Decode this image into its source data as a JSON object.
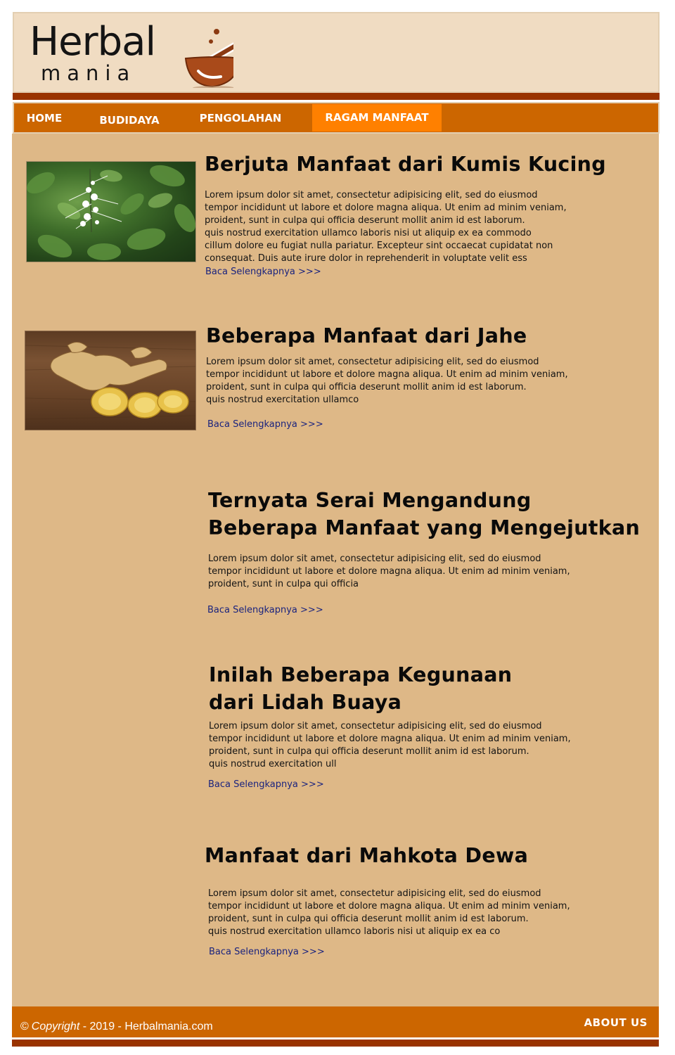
{
  "brand": {
    "logo_top": "Herbal",
    "logo_bottom": "mania"
  },
  "nav": [
    {
      "label": "HOME"
    },
    {
      "label": "BUDIDAYA"
    },
    {
      "label": "PENGOLAHAN"
    },
    {
      "label": "RAGAM MANFAAT",
      "active": true
    }
  ],
  "articles": [
    {
      "title": "Berjuta Manfaat dari Kumis Kucing",
      "body": [
        "Lorem ipsum dolor sit amet, consectetur adipisicing elit, sed do eiusmod",
        "tempor incididunt ut labore et dolore magna aliqua. Ut enim ad minim veniam,",
        "proident, sunt in culpa qui officia deserunt mollit anim id est laborum.",
        "quis nostrud exercitation ullamco laboris nisi ut aliquip ex ea commodo",
        "cillum dolore eu fugiat nulla pariatur. Excepteur sint occaecat cupidatat non",
        "consequat. Duis aute irure dolor in reprehenderit in voluptate velit ess"
      ],
      "link": "Baca Selengkapnya >>>",
      "image": "kumis-kucing-photo"
    },
    {
      "title": "Beberapa Manfaat dari Jahe",
      "body": [
        "Lorem ipsum dolor sit amet, consectetur adipisicing elit, sed do eiusmod",
        "tempor incididunt ut labore et dolore magna aliqua. Ut enim ad minim veniam,",
        "proident, sunt in culpa qui officia deserunt mollit anim id est laborum.",
        "quis nostrud exercitation ullamco"
      ],
      "link": "Baca Selengkapnya >>>",
      "image": "jahe-photo"
    },
    {
      "title_lines": [
        "Ternyata Serai Mengandung",
        "Beberapa Manfaat yang Mengejutkan"
      ],
      "body": [
        "Lorem ipsum dolor sit amet, consectetur adipisicing elit, sed do eiusmod",
        "tempor incididunt ut labore et dolore magna aliqua. Ut enim ad minim veniam,",
        "proident, sunt in culpa qui officia"
      ],
      "link": "Baca Selengkapnya >>>"
    },
    {
      "title_lines": [
        "Inilah Beberapa Kegunaan",
        "dari Lidah Buaya"
      ],
      "body": [
        "Lorem ipsum dolor sit amet, consectetur adipisicing elit, sed do eiusmod",
        "tempor incididunt ut labore et dolore magna aliqua. Ut enim ad minim veniam,",
        "proident, sunt in culpa qui officia deserunt mollit anim id est laborum.",
        "quis nostrud exercitation ull"
      ],
      "link": "Baca Selengkapnya >>>"
    },
    {
      "title": "Manfaat dari Mahkota Dewa",
      "body": [
        "Lorem ipsum dolor sit amet, consectetur adipisicing elit, sed do eiusmod",
        "tempor incididunt ut labore et dolore magna aliqua. Ut enim ad minim veniam,",
        "proident, sunt in culpa qui officia deserunt mollit anim id est laborum.",
        "quis nostrud exercitation ullamco laboris nisi ut aliquip ex ea co"
      ],
      "link": "Baca Selengkapnya >>>"
    }
  ],
  "footer": {
    "copyright_symbol": "©",
    "copyright_word": "Copyright",
    "copyright_rest": " - 2019 - Herbalmania.com",
    "about": "ABOUT US"
  },
  "colors": {
    "header_bg": "#f0dcc2",
    "accent_dark": "#993300",
    "nav_bg": "#cc6600",
    "nav_active": "#ff8000",
    "content_bg": "#deb887",
    "link": "#1a237e"
  }
}
